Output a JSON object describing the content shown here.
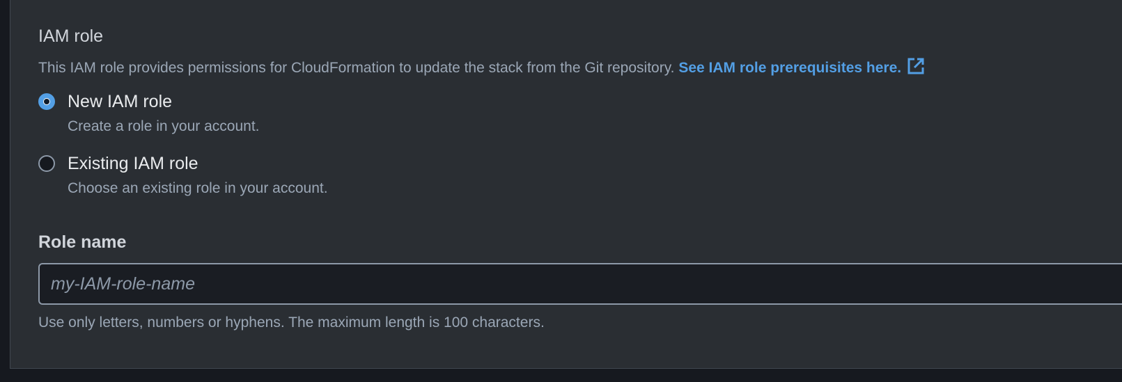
{
  "iam_role": {
    "title": "IAM role",
    "description": "This IAM role provides permissions for CloudFormation to update the stack from the Git repository.",
    "link_text": "See IAM role prerequisites here.",
    "link_icon": "external-link-icon",
    "options": [
      {
        "label": "New IAM role",
        "description": "Create a role in your account.",
        "selected": true
      },
      {
        "label": "Existing IAM role",
        "description": "Choose an existing role in your account.",
        "selected": false
      }
    ]
  },
  "role_name": {
    "label": "Role name",
    "value": "",
    "placeholder": "my-IAM-role-name",
    "constraint": "Use only letters, numbers or hyphens. The maximum length is 100 characters."
  },
  "colors": {
    "accent": "#539fe5",
    "panel_background": "#2a2e33",
    "page_background": "#16191f",
    "input_background": "#1a1d23",
    "secondary_text": "#9ba7b6",
    "primary_text": "#e9ebed"
  }
}
